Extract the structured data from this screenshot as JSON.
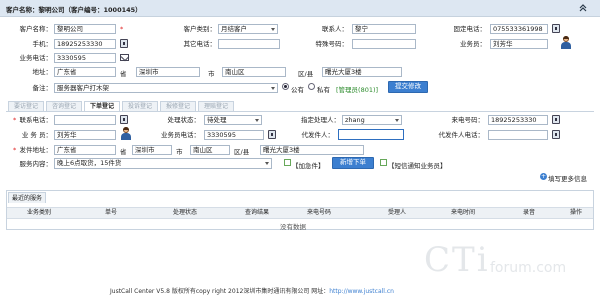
{
  "header": {
    "title_prefix": "客户名称：",
    "customer_name": "黎明公司",
    "customer_code": "（客户编号：1000145）"
  },
  "customer": {
    "name_label": "客户名称：",
    "name_value": "黎明公司",
    "category_label": "客户类别：",
    "category_value": "月结客户",
    "contact_label": "联系人：",
    "contact_value": "黎宁",
    "landline_label": "固定电话：",
    "landline_value": "075533361998",
    "mobile_label": "手机：",
    "mobile_value": "18925253330",
    "other_phone_label": "其它电话：",
    "special_label": "特殊号码：",
    "salesman_label": "业务员：",
    "salesman_value": "刘芳华",
    "sales_phone_label": "业务电话：",
    "sales_phone_value": "3330595",
    "address_label": "地址：",
    "province": "广东省",
    "province_unit": "省",
    "city": "深圳市",
    "city_unit": "市",
    "district": "南山区",
    "district_unit": "区/县",
    "street": "曙光大厦3楼",
    "note_label": "备注：",
    "note_value": "服务器客户打木架",
    "public_label": "公有",
    "private_label": "私有",
    "admin_tag": "[管理员(801)]",
    "submit_label": "提交修改"
  },
  "tabs": [
    {
      "label": "要访登记"
    },
    {
      "label": "咨询登记"
    },
    {
      "label": "下单登记"
    },
    {
      "label": "投诉登记"
    },
    {
      "label": "报修登记"
    },
    {
      "label": "理赔登记"
    }
  ],
  "order": {
    "contact_label": "联系电话：",
    "status_label": "处理状态：",
    "status_value": "待处理",
    "handler_label": "指定处理人：",
    "handler_value": "zhang",
    "incoming_label": "来电号码：",
    "incoming_value": "18925253330",
    "salesman_label": "业 务 员：",
    "salesman_value": "刘芳华",
    "sales_phone_label": "业务员电话：",
    "sales_phone_value": "3330595",
    "agent_label": "代发件人：",
    "agent_phone_label": "代发件人电话：",
    "ship_label": "发件地址：",
    "province": "广东省",
    "province_unit": "省",
    "city": "深圳市",
    "city_unit": "市",
    "district": "南山区",
    "district_unit": "区/县",
    "street": "曙光大厦3楼",
    "content_label": "服务内容：",
    "content_value": "晚上6点取货，15件货",
    "urgent_label": "【加急件】",
    "new_order_label": "新增下单",
    "notify_label": "【短信通知业务员】",
    "more_info_label": "填写更多信息"
  },
  "recent": {
    "tab_label": "最近的服务",
    "columns": [
      "业务类别",
      "单号",
      "处理状态",
      "查询结果",
      "来电号码",
      "受理人",
      "来电时间",
      "录音",
      "操作"
    ],
    "empty_text": "没有数据"
  },
  "footer": {
    "text": "JustCall Center V5.8 版权所有copy right 2012深圳市集时通讯有限公司 网址：",
    "url": "http://www.justcall.cn"
  },
  "watermark": {
    "brand": "CTi",
    "suffix": "forum.com"
  },
  "colors": {
    "header_bg": "#dde7f2",
    "accent_blue": "#3c7fd0",
    "required_red": "#e02020",
    "admin_green": "#2a8a2a"
  }
}
